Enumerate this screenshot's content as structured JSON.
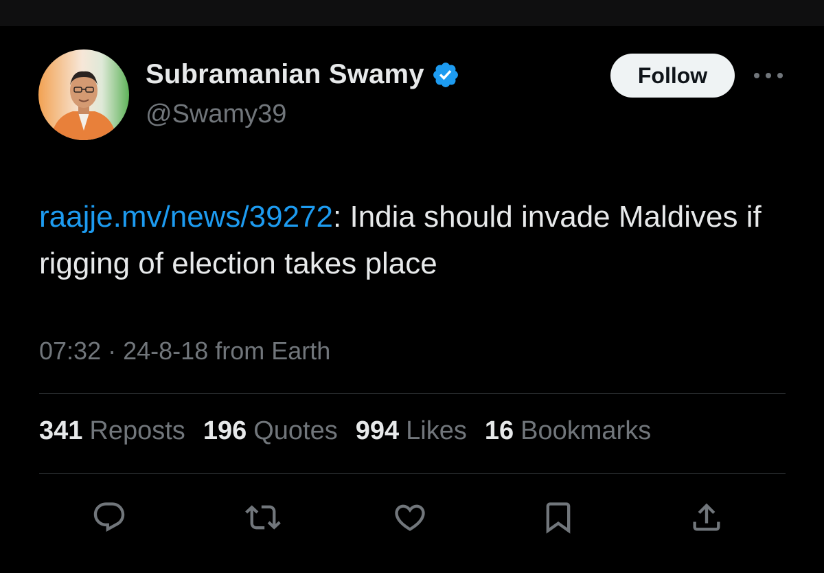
{
  "author": {
    "name": "Subramanian Swamy",
    "handle": "@Swamy39",
    "verified_color": "#1d9bf0"
  },
  "header": {
    "follow_label": "Follow",
    "more_icon": "more-icon"
  },
  "tweet": {
    "link_text": "raajje.mv/news/39272",
    "body_text": ": India should invade Maldives if rigging of election takes place",
    "link_color": "#1d9bf0"
  },
  "meta": {
    "time": "07:32",
    "separator": "·",
    "date_source": "24-8-18 from Earth"
  },
  "stats": [
    {
      "count": "341",
      "label": "Reposts"
    },
    {
      "count": "196",
      "label": "Quotes"
    },
    {
      "count": "994",
      "label": "Likes"
    },
    {
      "count": "16",
      "label": "Bookmarks"
    }
  ],
  "actions": [
    {
      "icon": "reply-icon"
    },
    {
      "icon": "repost-icon"
    },
    {
      "icon": "like-icon"
    },
    {
      "icon": "bookmark-icon"
    },
    {
      "icon": "share-icon"
    }
  ],
  "colors": {
    "background": "#000000",
    "text_primary": "#e7e9ea",
    "text_secondary": "#71767b",
    "divider": "#2f3336"
  }
}
